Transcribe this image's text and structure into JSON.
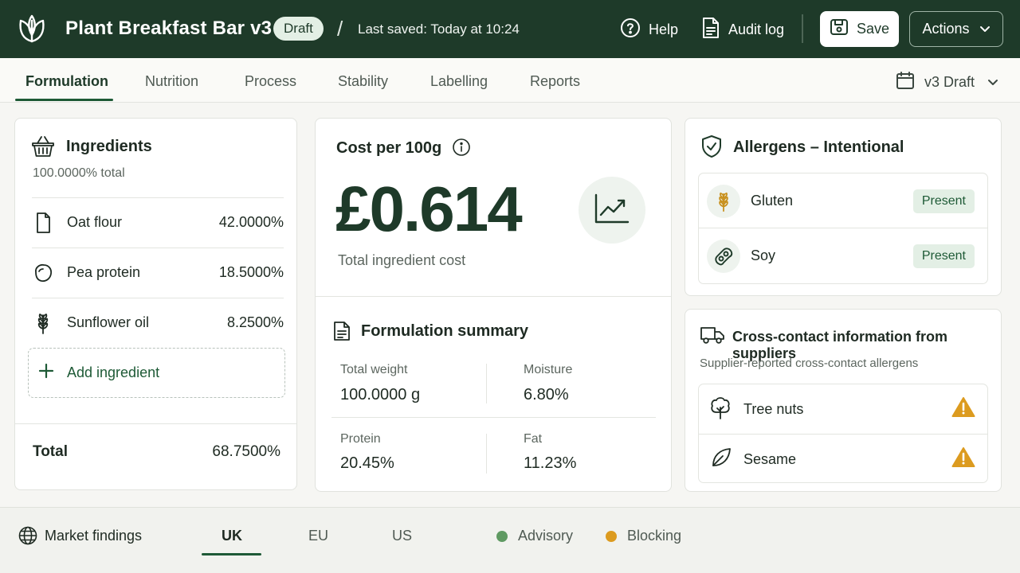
{
  "header": {
    "title": "Plant Breakfast Bar v3",
    "status_badge": "Draft",
    "separator": "/",
    "last_saved": "Last saved: Today at 10:24",
    "help_label": "Help",
    "audit_label": "Audit log",
    "save_label": "Save",
    "actions_label": "Actions"
  },
  "tabs": [
    "Formulation",
    "Nutrition",
    "Process",
    "Stability",
    "Labelling",
    "Reports"
  ],
  "active_tab": "Formulation",
  "version_select": {
    "selected": "v3 Draft"
  },
  "ingredients": {
    "title": "Ingredients",
    "total_pct": "100.0000% total",
    "items": [
      {
        "name": "Oat flour",
        "percent": "42.0000%",
        "icon": "file-icon"
      },
      {
        "name": "Pea protein",
        "percent": "18.5000%",
        "icon": "pea-icon"
      },
      {
        "name": "Sunflower oil",
        "percent": "8.2500%",
        "icon": "wheat-icon"
      }
    ],
    "add_label": "Add ingredient",
    "total_label": "Total",
    "total_value": "68.7500%"
  },
  "cost": {
    "title": "Cost per 100g",
    "value": "£0.614",
    "caption": "Total ingredient cost"
  },
  "summary": {
    "title": "Formulation summary",
    "metrics": [
      {
        "label": "Total weight",
        "value": "100.0000 g"
      },
      {
        "label": "Moisture",
        "value": "6.80%"
      },
      {
        "label": "Protein",
        "value": "20.45%"
      },
      {
        "label": "Fat",
        "value": "11.23%"
      }
    ]
  },
  "allergens": {
    "title": "Allergens – Intentional",
    "items": [
      {
        "name": "Gluten",
        "status": "Present",
        "icon": "wheat-icon"
      },
      {
        "name": "Soy",
        "status": "Present",
        "icon": "soy-icon"
      }
    ]
  },
  "cross_contact": {
    "title": "Cross-contact information from suppliers",
    "subtitle": "Supplier-reported cross-contact allergens",
    "items": [
      {
        "name": "Tree nuts",
        "icon": "tree-icon"
      },
      {
        "name": "Sesame",
        "icon": "leaf-icon"
      }
    ]
  },
  "footer": {
    "label": "Market findings",
    "markets": [
      "UK",
      "EU",
      "US"
    ],
    "active_market": "UK",
    "legend": [
      {
        "label": "Advisory",
        "color": "#5f9a62"
      },
      {
        "label": "Blocking",
        "color": "#dc9b1f"
      }
    ]
  },
  "colors": {
    "brand_dark": "#1e3a29",
    "accent": "#1e5a36",
    "warning": "#dc9b1f"
  }
}
